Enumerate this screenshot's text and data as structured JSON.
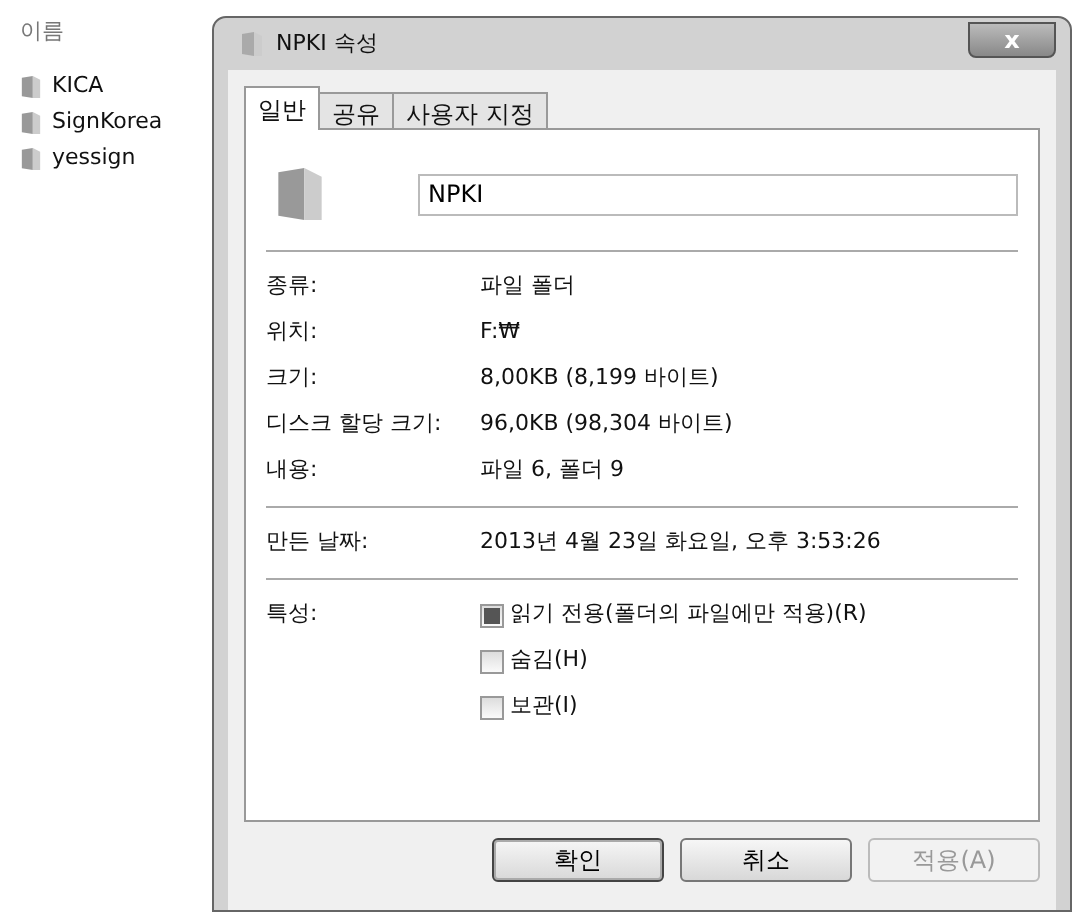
{
  "explorer": {
    "column_header": "이름",
    "items": [
      {
        "name": "KICA"
      },
      {
        "name": "SignKorea"
      },
      {
        "name": "yessign"
      }
    ]
  },
  "dialog": {
    "title": "NPKI 속성",
    "close_button": {
      "label": "x"
    },
    "tabs": [
      {
        "label": "일반",
        "selected": true
      },
      {
        "label": "공유",
        "selected": false
      },
      {
        "label": "사용자 지정",
        "selected": false
      }
    ],
    "name_field": {
      "value": "NPKI"
    },
    "info_groups": [
      [
        {
          "label": "종류:",
          "value": "파일 폴더"
        },
        {
          "label": "위치:",
          "value": "F:₩"
        },
        {
          "label": "크기:",
          "value": "8,00KB (8,199 바이트)"
        },
        {
          "label": "디스크 할당 크기:",
          "value": "96,0KB (98,304 바이트)"
        },
        {
          "label": "내용:",
          "value": "파일 6, 폴더 9"
        }
      ],
      [
        {
          "label": "만든 날짜:",
          "value": "2013년 4월 23일 화요일, 오후 3:53:26"
        }
      ]
    ],
    "attributes": {
      "label": "특성:",
      "options": [
        {
          "label": "읽기 전용(폴더의 파일에만 적용)(R)",
          "checked": false,
          "indeterminate": true
        },
        {
          "label": "숨김(H)",
          "checked": false,
          "indeterminate": false
        },
        {
          "label": "보관(I)",
          "checked": false,
          "indeterminate": false
        }
      ]
    },
    "buttons": [
      {
        "label": "확인",
        "disabled": false,
        "default": true
      },
      {
        "label": "취소",
        "disabled": false,
        "default": false
      },
      {
        "label": "적용(A)",
        "disabled": true,
        "default": false
      }
    ]
  }
}
